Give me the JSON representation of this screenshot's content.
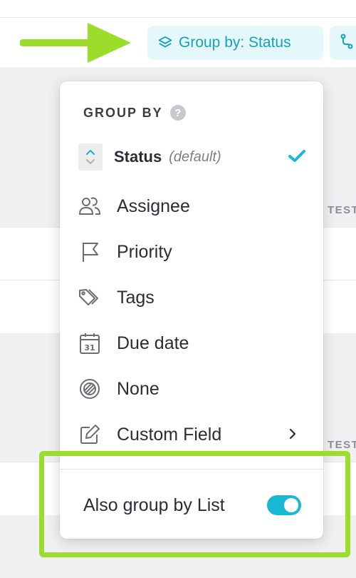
{
  "toolbar": {
    "group_chip_label": "Group by: Status"
  },
  "background": {
    "column_header": "TEST",
    "column_header_2": "TEST"
  },
  "dropdown": {
    "header": "GROUP BY",
    "help_glyph": "?",
    "status_label": "Status",
    "status_note": "(default)",
    "items": [
      {
        "label": "Assignee",
        "icon": "people-icon"
      },
      {
        "label": "Priority",
        "icon": "flag-icon"
      },
      {
        "label": "Tags",
        "icon": "tags-icon"
      },
      {
        "label": "Due date",
        "icon": "calendar-icon"
      },
      {
        "label": "None",
        "icon": "none-icon"
      },
      {
        "label": "Custom Field",
        "icon": "edit-icon"
      }
    ],
    "calendar_day": "31",
    "footer_label": "Also group by List",
    "also_group_by_list": true
  },
  "colors": {
    "accent": "#17a2b8",
    "toggle_on": "#18b9d3",
    "chip_bg": "#e4f8fb",
    "annotation_green": "#9bdd2a"
  }
}
